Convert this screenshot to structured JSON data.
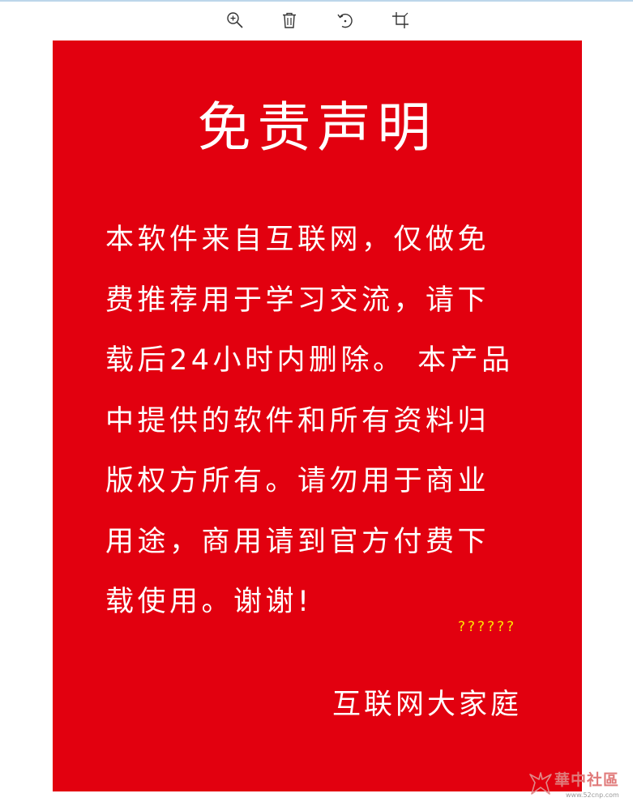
{
  "toolbar": {
    "icons": [
      "zoom-in-icon",
      "delete-icon",
      "rotate-icon",
      "crop-icon"
    ]
  },
  "poster": {
    "background_color": "#e2000f",
    "title": "免责声明",
    "body_lines": [
      "本软件来自互联网，仅做免",
      "费推荐用于学习交流，请下",
      "载后24小时内删除。 本产品",
      "中提供的软件和所有资料归",
      "版权方所有。请勿用于商业",
      "用途，商用请到官方付费下",
      "载使用。谢谢!"
    ],
    "garbled_text": "??????",
    "signature": "互联网大家庭"
  },
  "watermark": {
    "name": "華中社區",
    "url": "www.52cnp.com"
  }
}
